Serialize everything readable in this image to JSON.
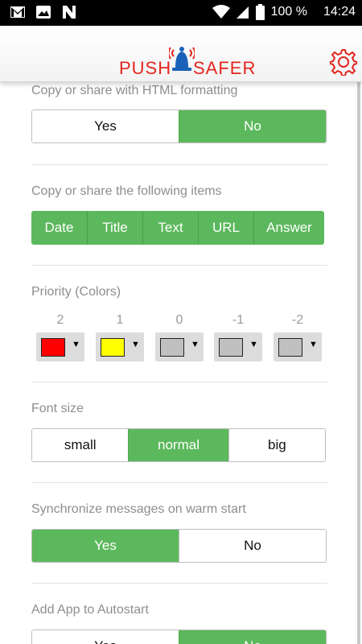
{
  "statusbar": {
    "icons_left": [
      "gmail-icon",
      "image-icon",
      "n-icon"
    ],
    "battery": "100 %",
    "time": "14:24"
  },
  "header": {
    "logo_left": "PUSH",
    "logo_right": "SAFER",
    "brand_color": "#e2261e"
  },
  "sections": {
    "html_formatting": {
      "label": "Copy or share with HTML formatting",
      "options": [
        "Yes",
        "No"
      ],
      "selected": "No"
    },
    "share_items": {
      "label": "Copy or share the following items",
      "items": [
        "Date",
        "Title",
        "Text",
        "URL",
        "Answer"
      ]
    },
    "priority": {
      "label": "Priority (Colors)",
      "levels": [
        {
          "num": "2",
          "color": "#ff0000"
        },
        {
          "num": "1",
          "color": "#ffff00"
        },
        {
          "num": "0",
          "color": "#c0c0c0"
        },
        {
          "num": "-1",
          "color": "#c0c0c0"
        },
        {
          "num": "-2",
          "color": "#c0c0c0"
        }
      ]
    },
    "font_size": {
      "label": "Font size",
      "options": [
        "small",
        "normal",
        "big"
      ],
      "selected": "normal"
    },
    "sync": {
      "label": "Synchronize messages on warm start",
      "options": [
        "Yes",
        "No"
      ],
      "selected": "Yes"
    },
    "autostart": {
      "label": "Add App to Autostart",
      "options": [
        "Yes",
        "No"
      ],
      "selected": "No"
    }
  },
  "colors": {
    "accent_green": "#5cb85c"
  }
}
